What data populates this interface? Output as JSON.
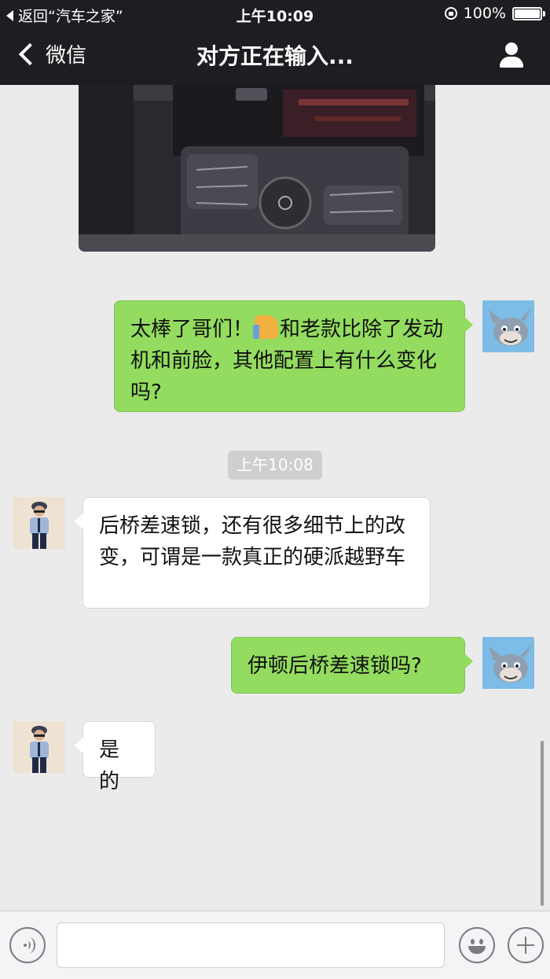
{
  "status_bar": {
    "back_app": "返回“汽车之家”",
    "time": "上午10:09",
    "battery": "100%"
  },
  "nav": {
    "back_label": "微信",
    "title": "对方正在输入..."
  },
  "messages": [
    {
      "side": "right",
      "text_a": "太棒了哥们！",
      "emoji": "thumbs-up",
      "text_b": "和老款比除了发动机和前脸，其他配置上有什么变化吗?"
    },
    {
      "type": "timestamp",
      "text": "上午10:08"
    },
    {
      "side": "left",
      "text": "后桥差速锁，还有很多细节上的改变，可谓是一款真正的硬派越野车"
    },
    {
      "side": "right",
      "text": "伊顿后桥差速锁吗?"
    },
    {
      "side": "left",
      "text": "是的"
    }
  ],
  "colors": {
    "header": "#1e1e22",
    "chat_bg": "#ebebeb",
    "bubble_right": "#93dc5f",
    "bubble_left": "#ffffff"
  }
}
